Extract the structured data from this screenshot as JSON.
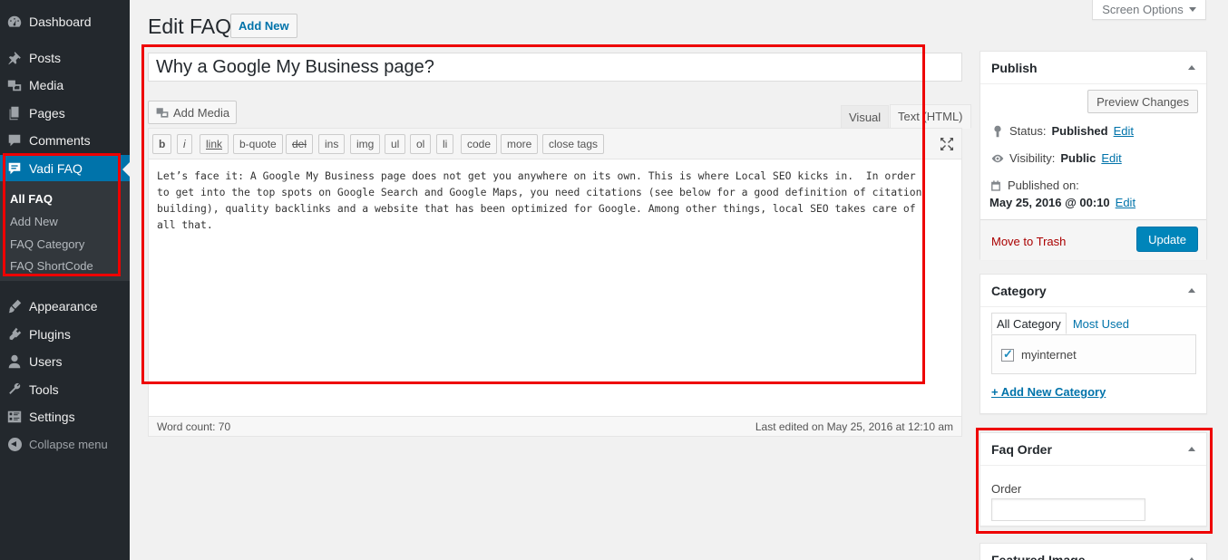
{
  "sidebar": {
    "items": [
      {
        "label": "Dashboard",
        "icon": "dashboard-icon"
      },
      {
        "label": "Posts",
        "icon": "pin-icon"
      },
      {
        "label": "Media",
        "icon": "media-icon"
      },
      {
        "label": "Pages",
        "icon": "pages-icon"
      },
      {
        "label": "Comments",
        "icon": "comment-icon"
      },
      {
        "label": "Vadi FAQ",
        "icon": "faq-icon"
      },
      {
        "label": "Appearance",
        "icon": "brush-icon"
      },
      {
        "label": "Plugins",
        "icon": "plugin-icon"
      },
      {
        "label": "Users",
        "icon": "user-icon"
      },
      {
        "label": "Tools",
        "icon": "wrench-icon"
      },
      {
        "label": "Settings",
        "icon": "settings-icon"
      }
    ],
    "submenu": [
      "All FAQ",
      "Add New",
      "FAQ Category",
      "FAQ ShortCode"
    ],
    "collapse_label": "Collapse menu"
  },
  "header": {
    "title": "Edit FAQ",
    "add_new": "Add New",
    "screen_options": "Screen Options"
  },
  "post": {
    "title": "Why a Google My Business page?",
    "content": "Let’s face it: A Google My Business page does not get you anywhere on its own. This is where Local SEO kicks in.  In order\nto get into the top spots on Google Search and Google Maps, you need citations (see below for a good definition of citation\nbuilding), quality backlinks and a website that has been optimized for Google. Among other things, local SEO takes care of\nall that."
  },
  "editor": {
    "add_media": "Add Media",
    "tab_visual": "Visual",
    "tab_text": "Text (HTML)",
    "quicktags": [
      "b",
      "i",
      "link",
      "b-quote",
      "del",
      "ins",
      "img",
      "ul",
      "ol",
      "li",
      "code",
      "more",
      "close tags"
    ],
    "word_count": "Word count: 70",
    "last_edited": "Last edited on May 25, 2016 at 12:10 am"
  },
  "publish": {
    "title": "Publish",
    "preview": "Preview Changes",
    "status_label": "Status:",
    "status_value": "Published",
    "visibility_label": "Visibility:",
    "visibility_value": "Public",
    "published_label": "Published on:",
    "published_value": "May 25, 2016 @ 00:10",
    "edit": "Edit",
    "trash": "Move to Trash",
    "update": "Update"
  },
  "category": {
    "title": "Category",
    "tab_all": "All Category",
    "tab_most_used": "Most Used",
    "items": [
      "myinternet"
    ],
    "add_new": "+ Add New Category"
  },
  "faq_order": {
    "title": "Faq Order",
    "label": "Order",
    "value": ""
  },
  "featured_image": {
    "title": "Featured Image"
  },
  "colors": {
    "sidebar_bg": "#23282d",
    "accent": "#0073aa",
    "annotation": "#e00000"
  }
}
